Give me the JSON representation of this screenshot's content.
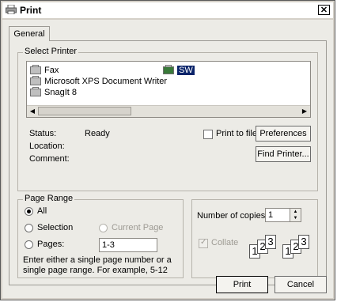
{
  "window": {
    "title": "Print",
    "close_glyph": "✕"
  },
  "tabs": [
    {
      "label": "General"
    }
  ],
  "select_printer": {
    "legend": "Select Printer",
    "printers": [
      {
        "name": "Fax",
        "icon": "printer-icon"
      },
      {
        "name": "Microsoft XPS Document Writer",
        "icon": "printer-icon"
      },
      {
        "name": "SnagIt 8",
        "icon": "printer-icon"
      },
      {
        "name": "SW",
        "icon": "network-printer-icon",
        "selected": true
      }
    ],
    "status_label": "Status:",
    "status_value": "Ready",
    "location_label": "Location:",
    "comment_label": "Comment:",
    "print_to_file_label": "Print to file",
    "print_to_file_checked": false,
    "preferences_label": "Preferences",
    "find_printer_label": "Find Printer..."
  },
  "page_range": {
    "legend": "Page Range",
    "all_label": "All",
    "selection_label": "Selection",
    "current_page_label": "Current Page",
    "pages_label": "Pages:",
    "pages_value": "1-3",
    "hint": "Enter either a single page number or a single page range.  For example, 5-12",
    "selected_option": "All"
  },
  "copies": {
    "label": "Number of copies:",
    "value": "1",
    "collate_label": "Collate",
    "collate_checked": true,
    "collate_enabled": false,
    "collate_pages": [
      "1",
      "2",
      "3"
    ]
  },
  "buttons": {
    "print_label": "Print",
    "cancel_label": "Cancel"
  }
}
